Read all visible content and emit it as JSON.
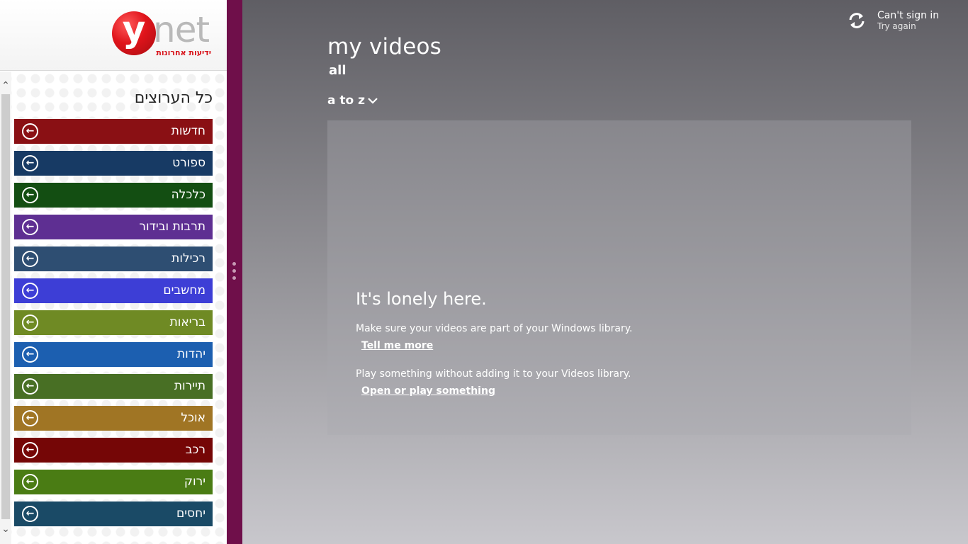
{
  "ynet": {
    "logo": {
      "ball_letter": "y",
      "wordmark": "net",
      "tagline": "ידיעות אחרונות"
    },
    "channels_title": "כל הערוצים",
    "channels": [
      {
        "label": "חדשות",
        "color": "#8a1014"
      },
      {
        "label": "ספורט",
        "color": "#173a64"
      },
      {
        "label": "כלכלה",
        "color": "#134e12"
      },
      {
        "label": "תרבות ובידור",
        "color": "#5e2f92"
      },
      {
        "label": "רכילות",
        "color": "#2e4e72"
      },
      {
        "label": "מחשבים",
        "color": "#3d3ed6"
      },
      {
        "label": "בריאות",
        "color": "#6f8a24"
      },
      {
        "label": "יהדות",
        "color": "#1c5fb0"
      },
      {
        "label": "תיירות",
        "color": "#486f24"
      },
      {
        "label": "אוכל",
        "color": "#a07524"
      },
      {
        "label": "רכב",
        "color": "#750606"
      },
      {
        "label": "ירוק",
        "color": "#4a7c14"
      },
      {
        "label": "יחסים",
        "color": "#1a4a66"
      }
    ],
    "scroll_up": "⌃",
    "scroll_down": "⌄",
    "channel_arrow": "←"
  },
  "videos": {
    "title": "my videos",
    "filter": "all",
    "sort_label": "a to z",
    "sort_chevron": "⌄",
    "signin": {
      "title": "Can't sign in",
      "subtitle": "Try again",
      "icon": "sync-icon"
    },
    "empty": {
      "heading": "It's lonely here.",
      "library_message": "Make sure your videos are part of your Windows library.",
      "tell_me_more": "Tell me more",
      "play_message": "Play something without adding it to your Videos library.",
      "open_play": "Open or play something"
    }
  },
  "colors": {
    "splitter": "#6f0f4a",
    "ynet_red": "#e0141b"
  }
}
